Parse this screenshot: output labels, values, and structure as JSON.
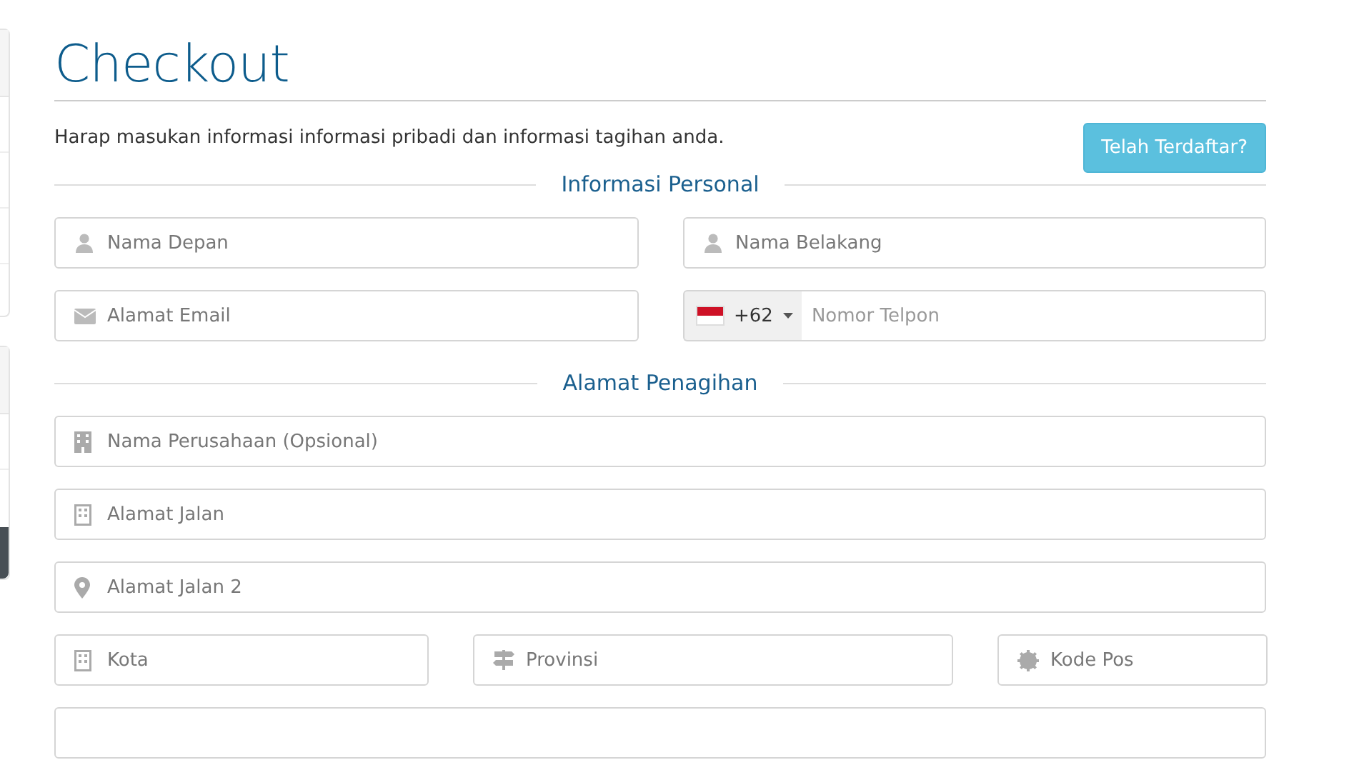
{
  "title": "Checkout",
  "description": "Harap masukan informasi informasi pribadi dan informasi tagihan anda.",
  "login_button": "Telah Terdaftar?",
  "personal": {
    "heading": "Informasi Personal",
    "rows": [
      [
        {
          "kind": "user",
          "placeholder": "Nama Depan"
        },
        {
          "kind": "user",
          "placeholder": "Nama Belakang"
        }
      ],
      [
        {
          "kind": "email",
          "placeholder": "Alamat Email"
        },
        {
          "kind": "phone",
          "country_code": "+62",
          "placeholder": "Nomor Telpon"
        }
      ]
    ]
  },
  "billing": {
    "heading": "Alamat Penagihan",
    "rows": [
      [
        {
          "kind": "company",
          "placeholder": "Nama Perusahaan (Opsional)"
        }
      ],
      [
        {
          "kind": "street",
          "placeholder": "Alamat Jalan"
        }
      ],
      [
        {
          "kind": "location",
          "placeholder": "Alamat Jalan 2"
        }
      ],
      [
        {
          "kind": "city",
          "placeholder": "Kota"
        },
        {
          "kind": "province",
          "placeholder": "Provinsi"
        },
        {
          "kind": "postcode",
          "placeholder": "Kode Pos"
        }
      ],
      [
        {
          "kind": "blank"
        }
      ]
    ]
  }
}
